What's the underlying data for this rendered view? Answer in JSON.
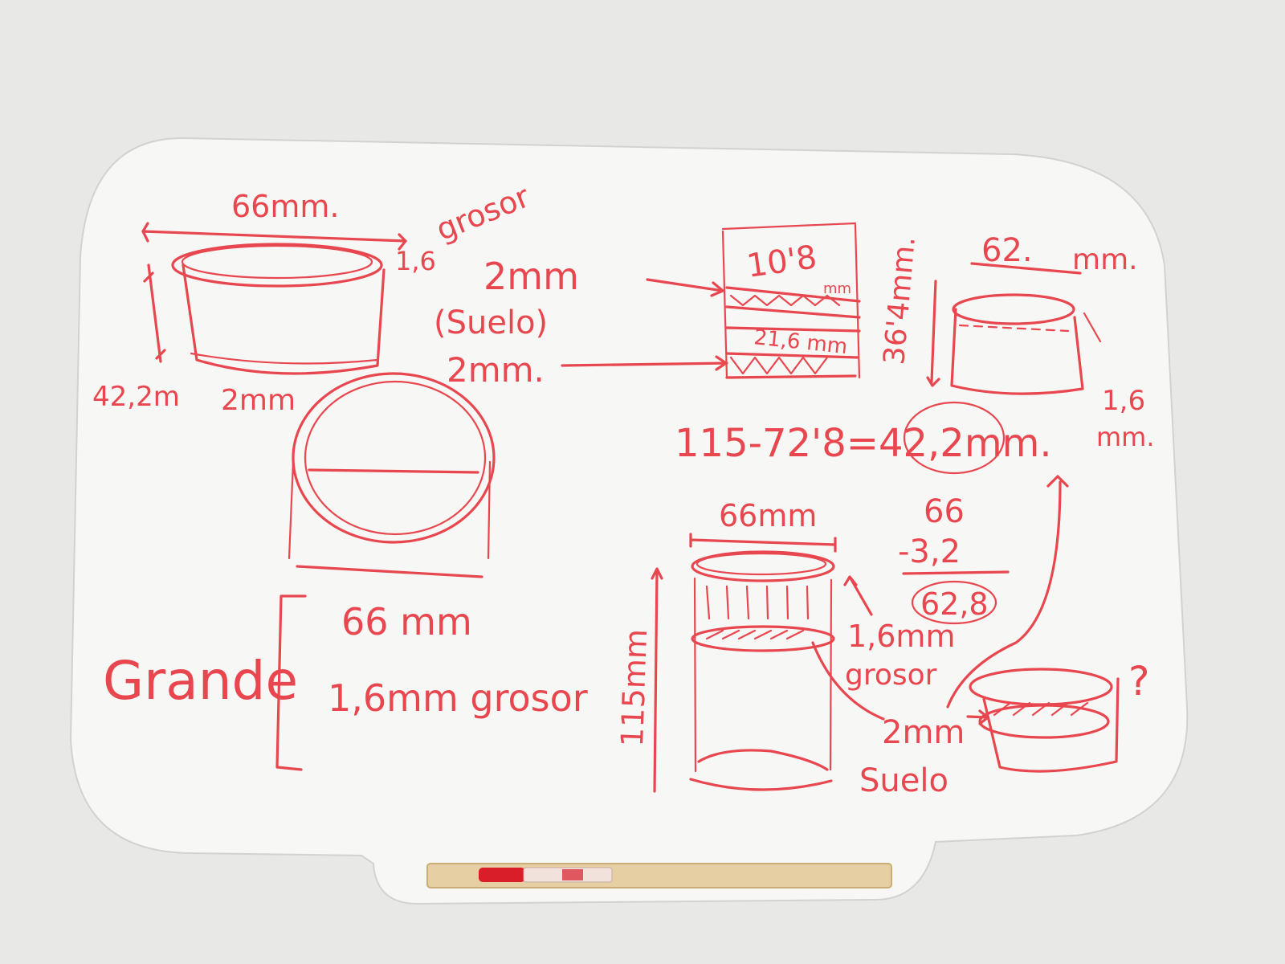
{
  "colors": {
    "wall": "#e7e7e5",
    "board": "#f7f7f5",
    "ink": "#e8474f",
    "ledge": "#e6cfa2"
  },
  "labels": {
    "top_left_width": "66mm.",
    "top_left_thickness": "1,6",
    "grosor_top": "grosor",
    "floor_thickness": "2mm",
    "suelo_paren": "(Suelo)",
    "floor_2mm": "2mm.",
    "height_left": "42,2m",
    "bottom_2mm": "2mm",
    "circle_width": "66mm",
    "grande": "Grande",
    "grande_width": "66 mm",
    "grande_thickness": "1,6mm grosor",
    "stack_top": "10'8",
    "stack_top_unit": "mm",
    "stack_mid": "21,6 mm",
    "equation": "115-72'8=42,2mm.",
    "right_height": "36'4mm.",
    "right_width": "62.",
    "right_width_unit": "mm.",
    "right_thickness": "1,6",
    "right_thickness_unit": "mm.",
    "center_width": "66mm",
    "sub_a": "66",
    "sub_b": "-3,2",
    "sub_result": "62,8",
    "center_height": "115mm",
    "center_thickness": "1,6mm",
    "center_grosor": "grosor",
    "center_floor": "2mm",
    "center_suelo": "Suelo",
    "question": "?"
  }
}
